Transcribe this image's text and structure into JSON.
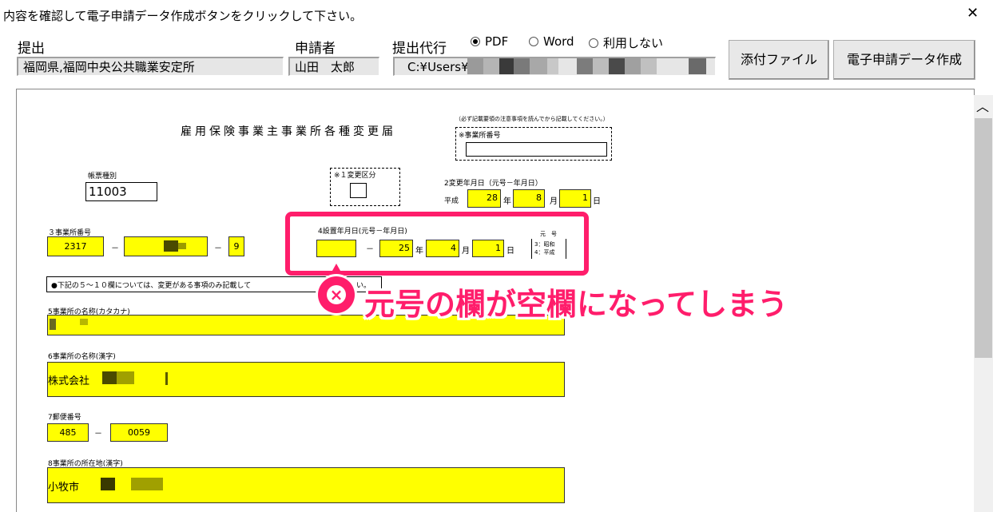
{
  "dialog": {
    "instruction": "内容を確認して電子申請データ作成ボタンをクリックして下さい。",
    "close_glyph": "✕"
  },
  "header": {
    "submit_label": "提出",
    "submit_value": "福岡県,福岡中央公共職業安定所",
    "applicant_label": "申請者",
    "applicant_value": "山田　太郎",
    "proxy_label": "提出代行",
    "path_value": "C:¥Users¥",
    "radio_options": [
      {
        "label": "PDF",
        "selected": true
      },
      {
        "label": "Word",
        "selected": false
      },
      {
        "label": "利用しない",
        "selected": false
      }
    ],
    "attach_button": "添付ファイル",
    "create_button": "電子申請データ作成"
  },
  "form": {
    "title": "雇用保険事業主事業所各種変更届",
    "note_top": "（必ず記載要領の注意事項を読んでから記載してください。）",
    "office_no_note": "※事業所番号",
    "form_type_label": "帳票種別",
    "form_type_value": "11003",
    "change_kbn_label": "※１変更区分",
    "change_date_label": "2変更年月日（元号－年月日）",
    "era_heisei": "平成",
    "change_year": "28",
    "change_month": "8",
    "change_day": "1",
    "unit_year": "年",
    "unit_month": "月",
    "unit_day": "日",
    "office_no_label": "３事業所番号",
    "office_no_1": "2317",
    "office_no_3": "9",
    "dash": "－",
    "est_date_label": "4設置年月日(元号－年月日)",
    "est_era_value": "",
    "est_year": "25",
    "est_month": "4",
    "est_day": "1",
    "gengo_title": "元　号",
    "gengo_opt1": "3：昭和",
    "gengo_opt2": "4：平成",
    "notice": "●下記の５～１０欄については、変更がある事項のみ記載して",
    "notice_tail": "い。",
    "kana_label": "5事業所の名称(カタカナ)",
    "kanji_label": "6事業所の名称(漢字)",
    "kanji_value": "株式会社",
    "postal_label": "7郵便番号",
    "postal_1": "485",
    "postal_2": "0059",
    "address_label": "8事業所の所在地(漢字)",
    "address_value": "小牧市"
  },
  "annotation": {
    "message": "元号の欄が空欄になってしまう",
    "color": "#ff1d6b"
  }
}
